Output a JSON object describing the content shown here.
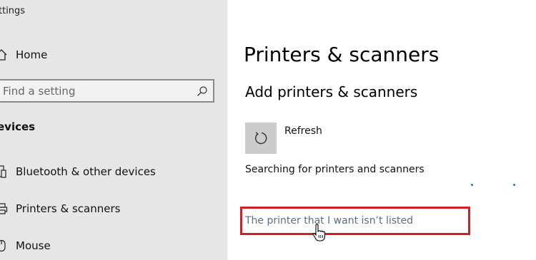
{
  "window": {
    "title": "ttings"
  },
  "sidebar": {
    "home_label": "Home",
    "search": {
      "placeholder": "Find a setting"
    },
    "section_header": "evices",
    "items": [
      {
        "label": "Bluetooth & other devices",
        "icon": "bluetooth-devices-icon"
      },
      {
        "label": "Printers & scanners",
        "icon": "printer-icon"
      },
      {
        "label": "Mouse",
        "icon": "mouse-icon"
      }
    ]
  },
  "main": {
    "page_title": "Printers & scanners",
    "subheading": "Add printers & scanners",
    "refresh_label": "Refresh",
    "status_text": "Searching for printers and scanners",
    "link_text": "The printer that I want isn’t listed"
  },
  "colors": {
    "sidebar_bg": "#e6e6e6",
    "highlight_box": "#d21f26",
    "link": "#5a6f86",
    "progress_dot": "#1a73c7"
  }
}
